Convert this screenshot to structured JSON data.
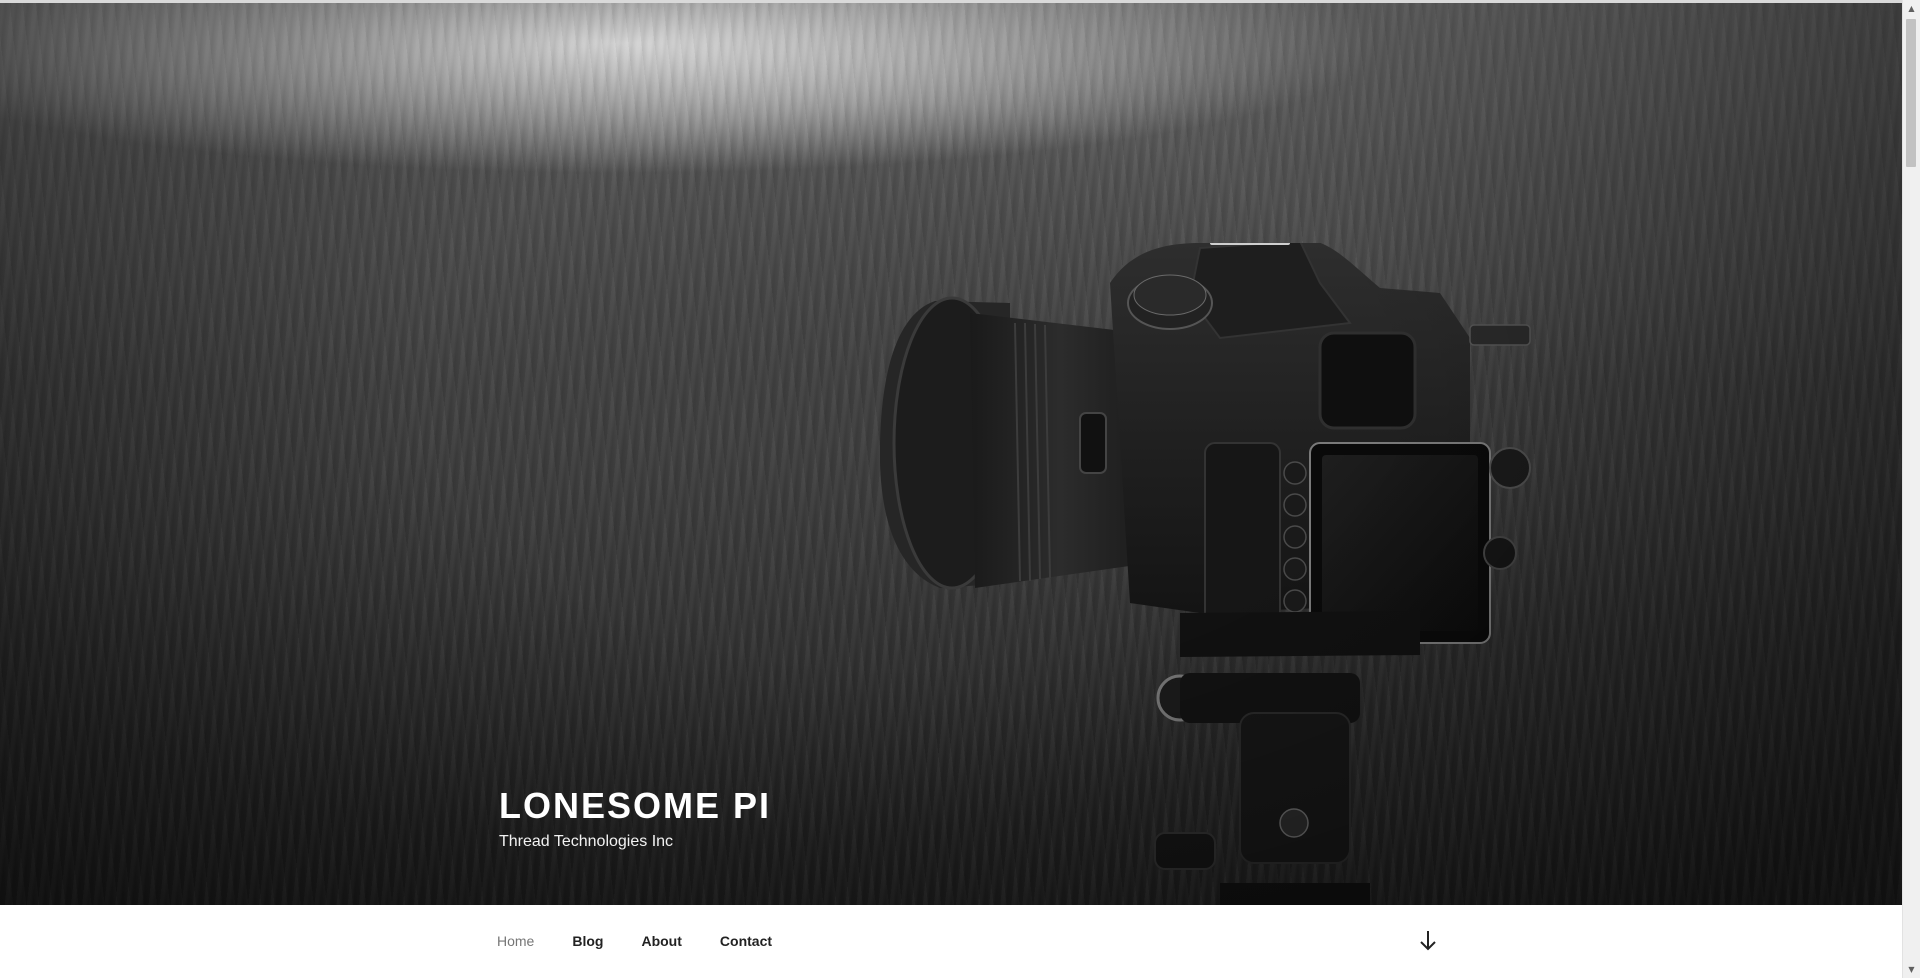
{
  "site": {
    "title": "LONESOME PI",
    "description": "Thread Technologies Inc"
  },
  "hero": {
    "image": "camera-on-tripod-photo"
  },
  "nav": {
    "items": [
      {
        "label": "Home",
        "current": true
      },
      {
        "label": "Blog",
        "current": false
      },
      {
        "label": "About",
        "current": false
      },
      {
        "label": "Contact",
        "current": false
      }
    ],
    "scroll_icon": "arrow-down-icon"
  },
  "scrollbar": {
    "up_icon": "triangle-up-icon",
    "down_icon": "triangle-down-icon"
  },
  "colors": {
    "title": "#ffffff",
    "nav_text": "#222222",
    "nav_current": "#767676"
  }
}
